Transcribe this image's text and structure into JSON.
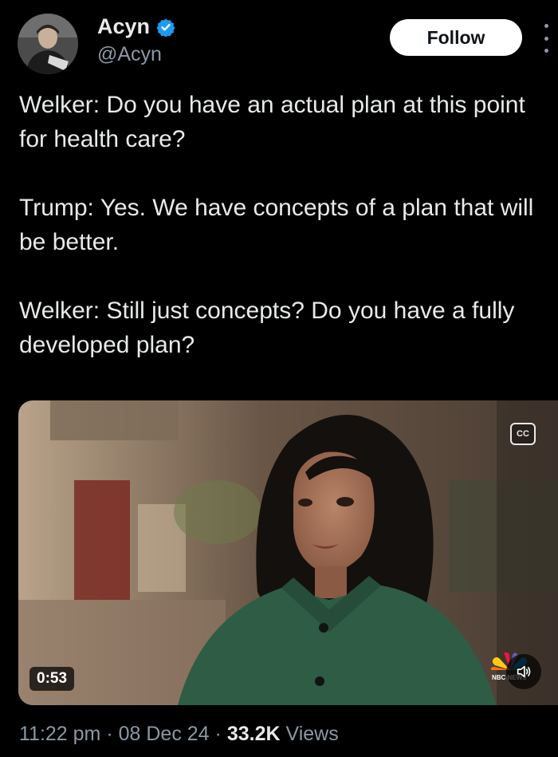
{
  "author": {
    "display_name": "Acyn",
    "handle": "@Acyn",
    "verified": true,
    "avatar_icon": "profile-photo"
  },
  "actions": {
    "follow_label": "Follow",
    "more_icon": "more-vertical-icon"
  },
  "tweet": {
    "paragraphs": [
      "Welker: Do you have an actual plan at this point for health care?",
      "Trump: Yes. We have concepts of a plan that will be better.",
      "Welker: Still just concepts? Do you have a fully developed plan?"
    ]
  },
  "video": {
    "cc_label": "CC",
    "duration": "0:53",
    "network_label": "NBC NEWS",
    "mute_icon": "speaker-icon"
  },
  "meta": {
    "time": "11:22 pm",
    "separator": "·",
    "date": "08 Dec 24",
    "views_count": "33.2K",
    "views_label": "Views"
  },
  "colors": {
    "background": "#000000",
    "text": "#e7e9ea",
    "secondary_text": "#8b98a5",
    "verified_blue": "#1d9bf0",
    "jacket_green": "#2f5c45"
  }
}
